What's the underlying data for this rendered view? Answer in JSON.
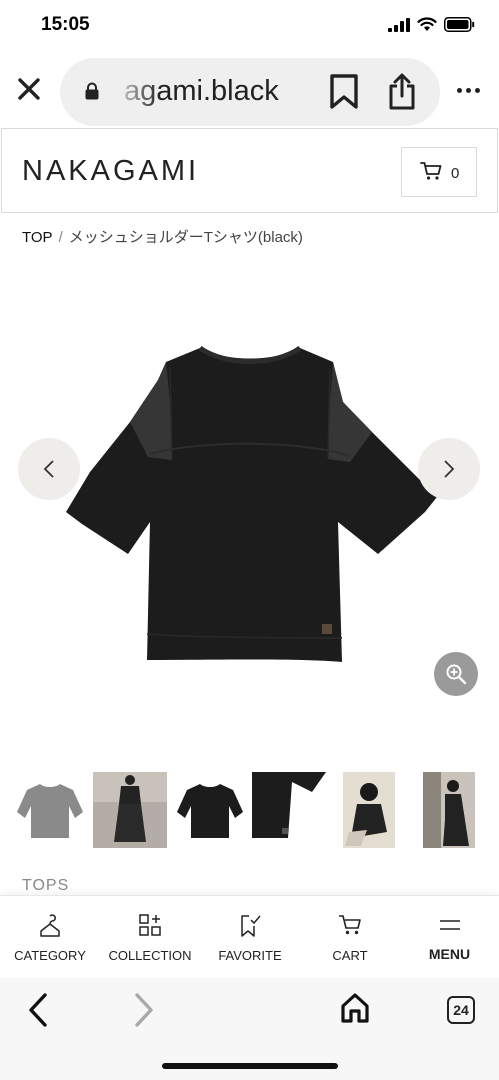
{
  "status": {
    "time": "15:05"
  },
  "browser": {
    "url_display": "agami.black",
    "tab_count": "24"
  },
  "site": {
    "logo": "NAKAGAMI",
    "cart_count": "0"
  },
  "breadcrumb": {
    "home": "TOP",
    "separator": "/",
    "current": "メッシュショルダーTシャツ(black)"
  },
  "product": {
    "category": "TOPS",
    "thumbnail_count": 6
  },
  "bottom_nav": {
    "items": [
      {
        "label": "CATEGORY",
        "icon": "hanger-icon"
      },
      {
        "label": "COLLECTION",
        "icon": "grid-plus-icon"
      },
      {
        "label": "FAVORITE",
        "icon": "bookmark-check-icon"
      },
      {
        "label": "CART",
        "icon": "cart-icon"
      },
      {
        "label": "MENU",
        "icon": "menu-icon"
      }
    ]
  },
  "colors": {
    "garment": "#1c1c1c",
    "arrow_button_bg": "#efedea",
    "zoom_button_bg": "#9a9a9a"
  }
}
